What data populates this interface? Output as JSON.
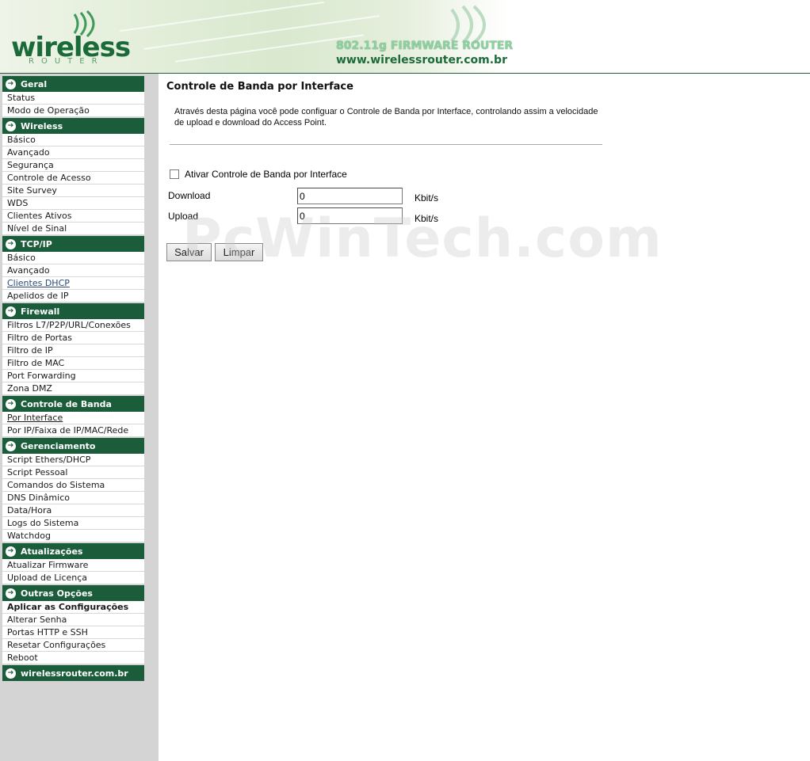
{
  "header": {
    "logo_text": "wireless",
    "logo_sub": "ROUTER",
    "firmware_title": "802.11g FIRMWARE ROUTER",
    "url": "www.wirelessrouter.com.br"
  },
  "sidebar": {
    "sections": [
      {
        "title": "Geral",
        "items": [
          "Status",
          "Modo de Operação"
        ]
      },
      {
        "title": "Wireless",
        "items": [
          "Básico",
          "Avançado",
          "Segurança",
          "Controle de Acesso",
          "Site Survey",
          "WDS",
          "Clientes Ativos",
          "Nível de Sinal"
        ]
      },
      {
        "title": "TCP/IP",
        "items": [
          "Básico",
          "Avançado",
          "Clientes DHCP",
          "Apelidos de IP"
        ]
      },
      {
        "title": "Firewall",
        "items": [
          "Filtros L7/P2P/URL/Conexões",
          "Filtro de Portas",
          "Filtro de IP",
          "Filtro de MAC",
          "Port Forwarding",
          "Zona DMZ"
        ]
      },
      {
        "title": "Controle de Banda",
        "items": [
          "Por Interface",
          "Por IP/Faixa de IP/MAC/Rede"
        ]
      },
      {
        "title": "Gerenciamento",
        "items": [
          "Script Ethers/DHCP",
          "Script Pessoal",
          "Comandos do Sistema",
          "DNS Dinâmico",
          "Data/Hora",
          "Logs do Sistema",
          "Watchdog"
        ]
      },
      {
        "title": "Atualizações",
        "items": [
          "Atualizar Firmware",
          "Upload de Licença"
        ]
      },
      {
        "title": "Outras Opções",
        "items": [
          "Aplicar as Configurações",
          "Alterar Senha",
          "Portas HTTP e SSH",
          "Resetar Configurações",
          "Reboot"
        ]
      },
      {
        "title": "wirelessrouter.com.br",
        "items": []
      }
    ],
    "visited_item": "Clientes DHCP",
    "active_item": "Por Interface",
    "bold_item": "Aplicar as Configurações"
  },
  "main": {
    "title": "Controle de Banda por Interface",
    "description": "Através desta página você pode configuar o Controle de Banda por Interface, controlando assim a velocidade de upload e download do Access Point.",
    "checkbox_label": "Ativar Controle de Banda por Interface",
    "checkbox_checked": false,
    "download_label": "Download",
    "download_value": "0",
    "download_unit": "Kbit/s",
    "upload_label": "Upload",
    "upload_value": "0",
    "upload_unit": "Kbit/s",
    "save_label": "Salvar",
    "clear_label": "Limpar"
  },
  "watermark": "PcWinTech.com",
  "colors": {
    "menu_header_bg": "#1b5c3b",
    "sidebar_bg": "#d4d4d4",
    "brand_green": "#1b6b3a"
  }
}
